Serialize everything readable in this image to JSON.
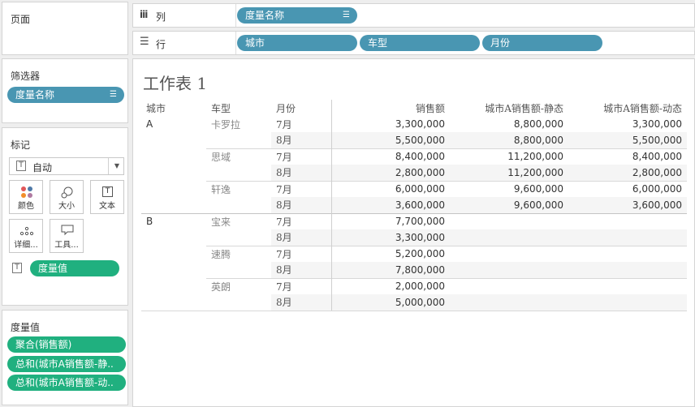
{
  "pages_panel": {
    "title": "页面"
  },
  "filters_panel": {
    "title": "筛选器",
    "pill": "度量名称"
  },
  "marks_panel": {
    "title": "标记",
    "type_value": "自动",
    "buttons": [
      {
        "label": "颜色",
        "icon": "color-dots-icon"
      },
      {
        "label": "大小",
        "icon": "size-icon"
      },
      {
        "label": "文本",
        "icon": "text-icon"
      },
      {
        "label": "详细...",
        "icon": "detail-icon"
      },
      {
        "label": "工具...",
        "icon": "tooltip-icon"
      }
    ],
    "measure_pill": "度量值"
  },
  "measure_values_panel": {
    "title": "度量值",
    "pills": [
      "聚合(销售额)",
      "总和(城市A销售额-静..",
      "总和(城市A销售额-动.."
    ]
  },
  "columns_shelf": {
    "label": "列",
    "pills": [
      "度量名称"
    ]
  },
  "rows_shelf": {
    "label": "行",
    "pills": [
      "城市",
      "车型",
      "月份"
    ]
  },
  "worksheet": {
    "title": "工作表 1",
    "headers": [
      "城市",
      "车型",
      "月份",
      "销售额",
      "城市A销售额-静态",
      "城市A销售额-动态"
    ],
    "rows": [
      {
        "city": "A",
        "car": "卡罗拉",
        "month": "7月",
        "v1": "3,300,000",
        "v2": "8,800,000",
        "v3": "3,300,000"
      },
      {
        "city": "",
        "car": "",
        "month": "8月",
        "v1": "5,500,000",
        "v2": "8,800,000",
        "v3": "5,500,000"
      },
      {
        "city": "",
        "car": "思域",
        "month": "7月",
        "v1": "8,400,000",
        "v2": "11,200,000",
        "v3": "8,400,000"
      },
      {
        "city": "",
        "car": "",
        "month": "8月",
        "v1": "2,800,000",
        "v2": "11,200,000",
        "v3": "2,800,000"
      },
      {
        "city": "",
        "car": "轩逸",
        "month": "7月",
        "v1": "6,000,000",
        "v2": "9,600,000",
        "v3": "6,000,000"
      },
      {
        "city": "",
        "car": "",
        "month": "8月",
        "v1": "3,600,000",
        "v2": "9,600,000",
        "v3": "3,600,000"
      },
      {
        "city": "B",
        "car": "宝来",
        "month": "7月",
        "v1": "7,700,000",
        "v2": "",
        "v3": ""
      },
      {
        "city": "",
        "car": "",
        "month": "8月",
        "v1": "3,300,000",
        "v2": "",
        "v3": ""
      },
      {
        "city": "",
        "car": "速腾",
        "month": "7月",
        "v1": "5,200,000",
        "v2": "",
        "v3": ""
      },
      {
        "city": "",
        "car": "",
        "month": "8月",
        "v1": "7,800,000",
        "v2": "",
        "v3": ""
      },
      {
        "city": "",
        "car": "英朗",
        "month": "7月",
        "v1": "2,000,000",
        "v2": "",
        "v3": ""
      },
      {
        "city": "",
        "car": "",
        "month": "8月",
        "v1": "5,000,000",
        "v2": "",
        "v3": ""
      }
    ]
  },
  "colors": {
    "blue_pill": "#4996b2",
    "green_pill": "#20b07f"
  }
}
